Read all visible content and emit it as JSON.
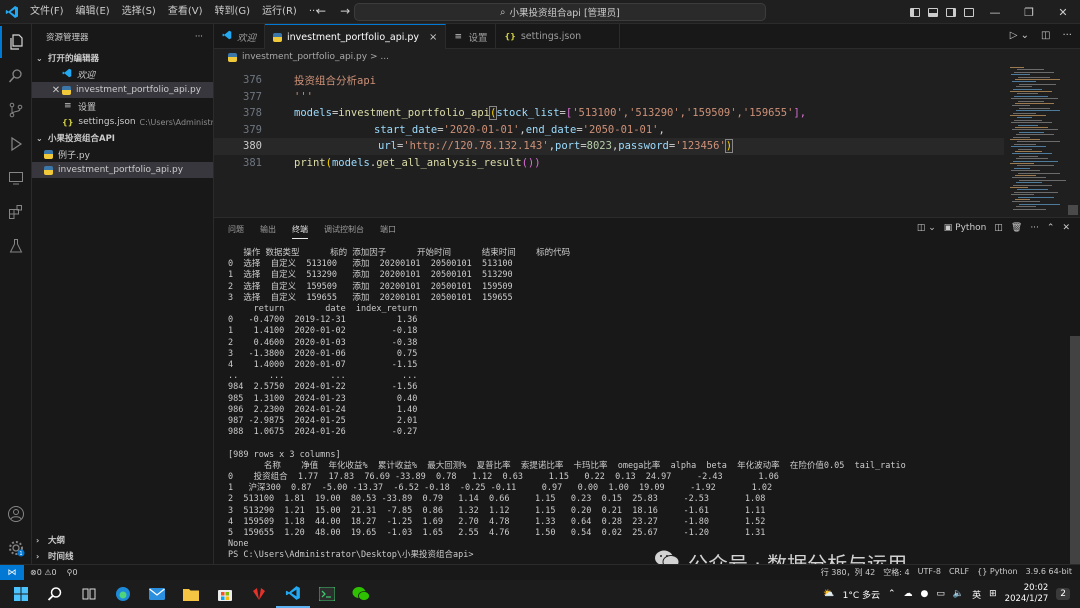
{
  "titlebar": {
    "menu": [
      "文件(F)",
      "编辑(E)",
      "选择(S)",
      "查看(V)",
      "转到(G)",
      "运行(R)",
      "···"
    ],
    "search": "小果投资组合api [管理员]"
  },
  "sidebar": {
    "header": "资源管理器",
    "more": "···",
    "open_editors": "打开的编辑器",
    "open_items": [
      {
        "label": "欢迎",
        "icon": "vscode-icon"
      },
      {
        "label": "investment_portfolio_api.py",
        "icon": "python-icon"
      },
      {
        "label": "设置",
        "icon": "settings-icon"
      },
      {
        "label": "settings.json",
        "path": "C:\\Users\\Administra...",
        "icon": "json-icon"
      }
    ],
    "folder": "小果投资组合API",
    "files": [
      "例子.py",
      "investment_portfolio_api.py"
    ],
    "outline": "大纲",
    "timeline": "时间线"
  },
  "tabs": [
    {
      "label": "欢迎",
      "icon": "vscode-icon"
    },
    {
      "label": "investment_portfolio_api.py",
      "icon": "python-icon",
      "close": "×"
    },
    {
      "label": "设置",
      "icon": "settings-icon"
    },
    {
      "label": "settings.json",
      "icon": "json-icon"
    }
  ],
  "breadcrumb": "investment_portfolio_api.py > ...",
  "editor": {
    "line_numbers": [
      "376",
      "377",
      "378",
      "379",
      "380",
      "381"
    ],
    "lines": [
      {
        "comment": "投资组合分析api"
      },
      {
        "comment": "'''"
      },
      {
        "var": "models",
        "op": "=",
        "fn": "investment_portfolio_api",
        "p1": "(",
        "arg": "stock_list",
        "eq": "=",
        "b1": "[",
        "vals": "'513100','513290','159509','159655'",
        "b2": "],"
      },
      {
        "arg1": "start_date",
        "eq1": "=",
        "s1": "'2020-01-01'",
        "c1": ",",
        "arg2": "end_date",
        "eq2": "=",
        "s2": "'2050-01-01'",
        "c2": ","
      },
      {
        "arg1": "url",
        "eq1": "=",
        "s1": "'http://120.78.132.143'",
        "c1": ",",
        "arg2": "port",
        "eq2": "=",
        "n2": "8023",
        "c2": ",",
        "arg3": "password",
        "eq3": "=",
        "s3": "'123456'",
        "p2": ")"
      },
      {
        "fn": "print",
        "p1": "(",
        "var": "models",
        "dot": ".",
        "method": "get_all_analysis_result",
        "p2": "())"
      }
    ]
  },
  "panel": {
    "tabs": [
      "问题",
      "输出",
      "终端",
      "调试控制台",
      "端口"
    ],
    "active_tab": "终端",
    "shell": "Python",
    "terminal_lines": [
      "   操作 数据类型      标的 添加因子      开始时间      结束时间    标的代码",
      "0  选择  自定义  513100   添加  20200101  20500101  513100",
      "1  选择  自定义  513290   添加  20200101  20500101  513290",
      "2  选择  自定义  159509   添加  20200101  20500101  159509",
      "3  选择  自定义  159655   添加  20200101  20500101  159655",
      "     return        date  index_return",
      "0   -0.4700  2019-12-31          1.36",
      "1    1.4100  2020-01-02         -0.18",
      "2    0.4600  2020-01-03         -0.38",
      "3   -1.3800  2020-01-06          0.75",
      "4    1.4000  2020-01-07         -1.15",
      "..      ...         ...           ...",
      "984  2.5750  2024-01-22         -1.56",
      "985  1.3100  2024-01-23          0.40",
      "986  2.2300  2024-01-24          1.40",
      "987 -2.9875  2024-01-25          2.01",
      "988  1.0675  2024-01-26         -0.27",
      "",
      "[989 rows x 3 columns]",
      "       名称    净值  年化收益%  累计收益%  最大回测%  夏普比率  索提诺比率  卡玛比率  omega比率  alpha  beta  年化波动率  在险价值0.05  tail_ratio",
      "0    投资组合  1.77  17.83  76.69 -33.89  0.78   1.12  0.63     1.15   0.22  0.13  24.97     -2.43       1.06",
      "1   沪深300  0.87  -5.00 -13.37  -6.52 -0.18  -0.25 -0.11     0.97   0.00  1.00  19.09     -1.92       1.02",
      "2  513100  1.81  19.00  80.53 -33.89  0.79   1.14  0.66     1.15   0.23  0.15  25.83     -2.53       1.08",
      "3  513290  1.21  15.00  21.31  -7.85  0.86   1.32  1.12     1.15   0.20  0.21  18.16     -1.61       1.11",
      "4  159509  1.18  44.00  18.27  -1.25  1.69   2.70  4.78     1.33   0.64  0.28  23.27     -1.80       1.52",
      "5  159655  1.20  48.00  19.65  -1.03  1.65   2.55  4.76     1.50   0.54  0.02  25.67     -1.20       1.31",
      "None",
      "PS C:\\Users\\Administrator\\Desktop\\小果投资组合api>"
    ]
  },
  "watermark": "公众号 · 数据分析与运用",
  "statusbar": {
    "problems": "⊗0 ⚠0",
    "ports": "⚲0",
    "right": [
      "行 380，列 42",
      "空格: 4",
      "UTF-8",
      "CRLF",
      "{} Python",
      "3.9.6 64-bit"
    ]
  },
  "taskbar": {
    "weather": "1°C 多云",
    "ime": "英",
    "time": "20:02",
    "date": "2024/1/27",
    "notifications": "2"
  },
  "colors": {
    "accent": "#0078d4",
    "editor_bg": "#1f1f1f",
    "sidebar_bg": "#181818"
  }
}
